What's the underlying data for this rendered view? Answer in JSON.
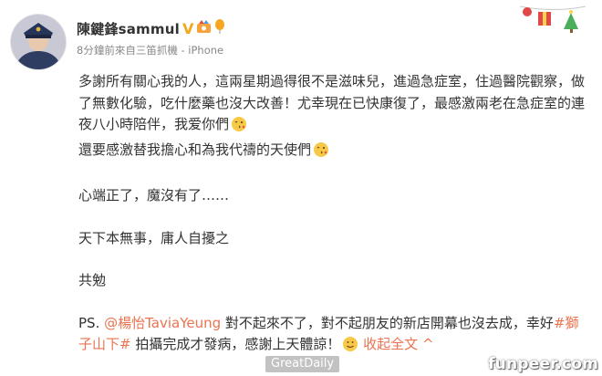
{
  "user": {
    "name": "陳鍵鋒sammul",
    "verified_badge": "V",
    "meta": "8分鐘前來自三笛抓機 - iPhone"
  },
  "post": {
    "para1": "多謝所有關心我的人，這兩星期過得很不是滋味兒，進過急症室，住過醫院觀察，做了無數化驗，吃什麼藥也沒大改善！尤幸現在已快康復了，最感激兩老在急症室的連夜八小時陪伴，我爱你們",
    "para2": "還要感激替我擔心和為我代禱的天使們",
    "line3": "心端正了，魔沒有了……",
    "line4": "天下本無事，庸人自擾之",
    "line5": "共勉",
    "ps_prefix": "PS. ",
    "ps_mention": "@楊怡TaviaYeung",
    "ps_mid": " 對不起來不了，對不起朋友的新店開幕也沒去成，幸好",
    "ps_topic": "#獅子山下#",
    "ps_tail": " 拍攝完成才發病，感謝上天體諒！",
    "collapse_label": "收起全文",
    "collapse_caret": "^"
  },
  "overlay": {
    "watermark": "GreatDaily",
    "site": "funpeer.com"
  },
  "colors": {
    "link": "#eb7350",
    "text": "#333333",
    "meta": "#888888",
    "verified": "#f2a81a"
  },
  "icons": [
    "avatar-photo",
    "verified-v-badge",
    "member-badge-icon",
    "balloon-icon",
    "kiss-emoji-icon",
    "smile-emoji-icon",
    "christmas-decoration"
  ]
}
